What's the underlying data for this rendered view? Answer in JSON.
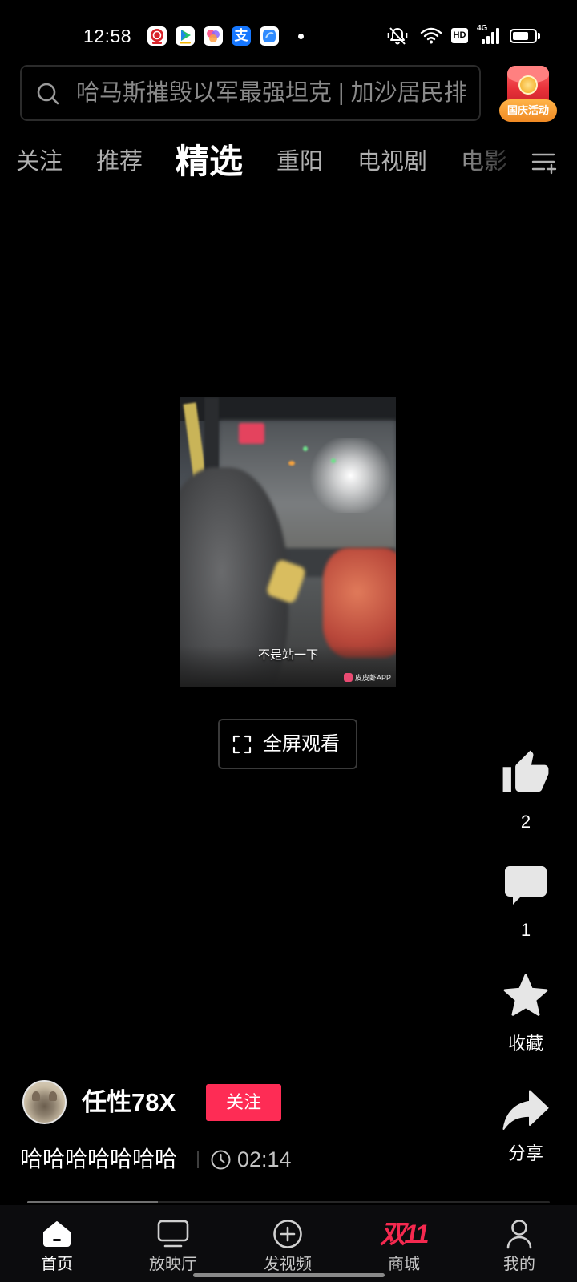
{
  "status_bar": {
    "time": "12:58",
    "notification_icons": [
      "red-app-icon",
      "play-app-icon",
      "photos-app-icon",
      "alipay-icon",
      "blue-app-icon"
    ],
    "alipay_glyph": "支",
    "status_icons": [
      "mute-icon",
      "wifi-icon",
      "hd-icon",
      "signal-icon",
      "battery-icon"
    ],
    "hd_label": "HD",
    "network_label": "4G",
    "battery_level": 0.72
  },
  "search": {
    "placeholder": "哈马斯摧毁以军最强坦克 | 加沙居民排",
    "icon": "search-icon"
  },
  "promo": {
    "icon": "red-envelope-icon",
    "label": "国庆活动"
  },
  "tabs": [
    {
      "label": "关注",
      "active": false
    },
    {
      "label": "推荐",
      "active": false
    },
    {
      "label": "精选",
      "active": true
    },
    {
      "label": "重阳",
      "active": false
    },
    {
      "label": "电视剧",
      "active": false
    },
    {
      "label": "电影",
      "active": false
    }
  ],
  "tab_menu_icon": "tab-menu-add-icon",
  "video": {
    "subtitle": "不是站一下",
    "watermark": "皮皮虾APP"
  },
  "fullscreen_button": {
    "icon": "fullscreen-icon",
    "label": "全屏观看"
  },
  "actions": {
    "like_icon": "thumbs-up-icon",
    "like_count": "2",
    "comment_icon": "comment-icon",
    "comment_count": "1",
    "favorite_icon": "star-icon",
    "favorite_label": "收藏",
    "share_icon": "share-icon",
    "share_label": "分享"
  },
  "author": {
    "name": "任性78X",
    "follow_label": "关注"
  },
  "description": {
    "text": "哈哈哈哈哈哈哈",
    "clock_icon": "clock-icon",
    "duration": "02:14"
  },
  "playback": {
    "progress": 0.25
  },
  "bottom_nav": [
    {
      "label": "首页",
      "icon": "home-icon",
      "active": true
    },
    {
      "label": "放映厅",
      "icon": "tv-icon",
      "active": false
    },
    {
      "label": "发视频",
      "icon": "plus-circle-icon",
      "active": false
    },
    {
      "label": "商城",
      "icon": "double-eleven-logo",
      "logo_text": "双11",
      "active": false
    },
    {
      "label": "我的",
      "icon": "person-icon",
      "active": false
    }
  ],
  "colors": {
    "background": "#000000",
    "follow_button": "#fe2c55",
    "double_eleven": "#f5294f",
    "active_tab": "#ffffff",
    "inactive_tab": "#b0b0b0"
  }
}
